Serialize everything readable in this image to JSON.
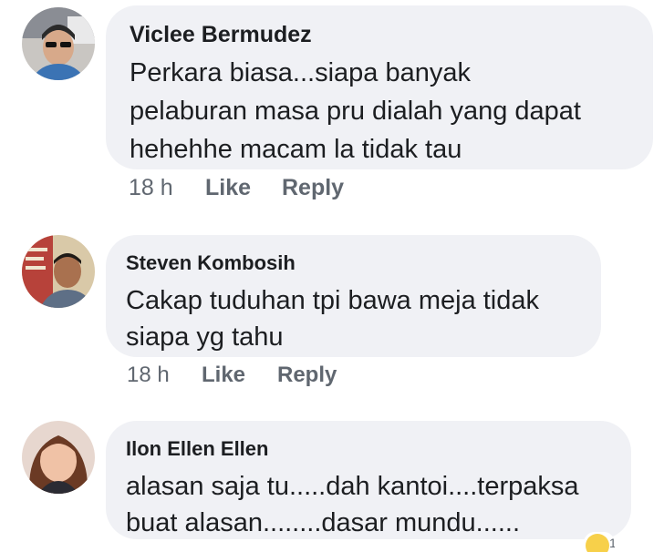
{
  "comments": [
    {
      "author": "Viclee Bermudez",
      "text_lines": [
        "Perkara biasa...siapa banyak",
        "pelaburan masa pru dialah yang dapat",
        "hehehhe macam la tidak tau"
      ],
      "time": "18 h",
      "like_label": "Like",
      "reply_label": "Reply"
    },
    {
      "author": "Steven Kombosih",
      "text_lines": [
        "Cakap tuduhan tpi bawa meja tidak",
        "siapa yg tahu"
      ],
      "time": "18 h",
      "like_label": "Like",
      "reply_label": "Reply"
    },
    {
      "author": "Ilon Ellen Ellen",
      "text_lines": [
        "alasan saja tu.....dah kantoi....terpaksa",
        "buat alasan........dasar mundu......"
      ]
    }
  ],
  "reaction": {
    "icon": "haha-emoji-icon",
    "count": "1"
  },
  "colors": {
    "bubble": "#f0f1f5",
    "meta_text": "#606770",
    "text": "#1c1e21"
  }
}
